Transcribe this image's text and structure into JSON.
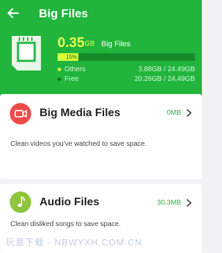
{
  "header": {
    "back_icon": "arrow-left-icon",
    "title": "Big Files",
    "bg_color": "#21b53c"
  },
  "storage": {
    "big_size": "0.35",
    "big_unit": "GB",
    "big_label": "Big Files",
    "progress_label": "15%",
    "progress_fraction": 0.15,
    "others_label": "Others",
    "others_value": "3.88GB / 24.49GB",
    "free_label": "Free",
    "free_value": "20.26GB / 24.49GB",
    "accent_color": "#eaff50"
  },
  "cards": [
    {
      "title": "Big Media Files",
      "size": "0MB",
      "desc": "Clean videos you've watched to save space.",
      "icon": "video-camera-icon",
      "icon_color": "#ee4a4a",
      "size_color": "#2fae4a"
    },
    {
      "title": "Audio Files",
      "size": "30.3MB",
      "desc": "Clean disliked songs to save space.",
      "icon": "music-note-icon",
      "icon_color": "#8fc43d",
      "size_color": "#2fae4a"
    }
  ],
  "watermark": "玩意下载 · NBWYXH.COM.CN"
}
